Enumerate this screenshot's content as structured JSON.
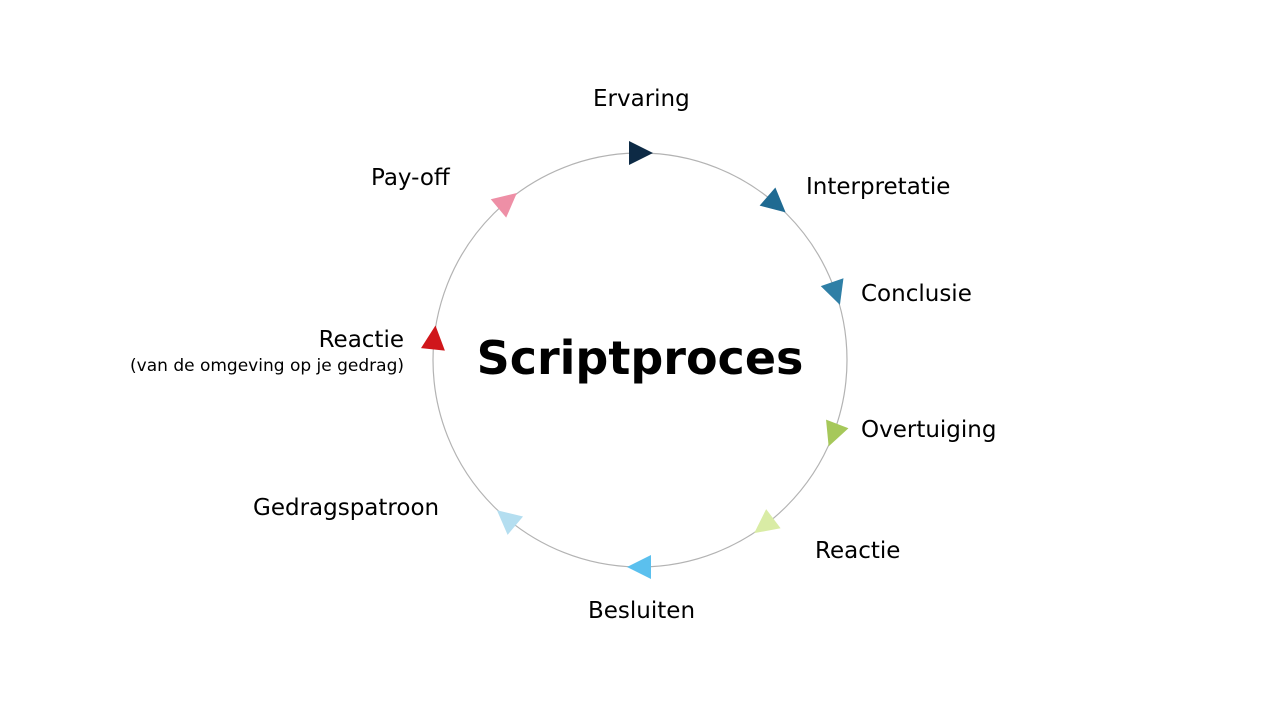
{
  "title": "Scriptproces",
  "steps": [
    {
      "label": "Ervaring",
      "color": "#0d2a45",
      "icon": "triangle-arrow-icon"
    },
    {
      "label": "Interpretatie",
      "color": "#1f6a92",
      "icon": "triangle-arrow-icon"
    },
    {
      "label": "Conclusie",
      "color": "#2f7fa6",
      "icon": "triangle-arrow-icon"
    },
    {
      "label": "Overtuiging",
      "color": "#a6c85a",
      "icon": "triangle-arrow-icon"
    },
    {
      "label": "Reactie",
      "color": "#d9eca5",
      "icon": "triangle-arrow-icon"
    },
    {
      "label": "Besluiten",
      "color": "#5bc0ee",
      "icon": "triangle-arrow-icon"
    },
    {
      "label": "Gedragspatroon",
      "color": "#b4def0",
      "icon": "triangle-arrow-icon"
    },
    {
      "label": "Reactie",
      "sublabel": "(van de omgeving op je gedrag)",
      "color": "#d0161b",
      "icon": "triangle-arrow-icon"
    },
    {
      "label": "Pay-off",
      "color": "#ee8fa6",
      "icon": "triangle-arrow-icon"
    }
  ]
}
